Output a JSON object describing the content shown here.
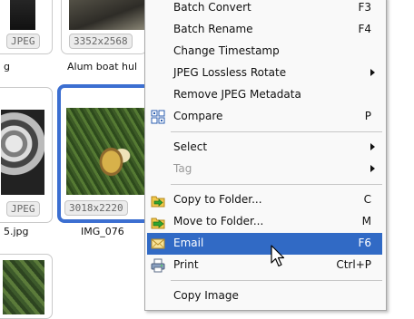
{
  "thumbnails": [
    {
      "badge": "JPEG",
      "name": ""
    },
    {
      "badge": "3352x2568",
      "name": "Alum boat hul"
    },
    {
      "badge": "JPEG",
      "name": "g"
    },
    {
      "badge": "JPEG",
      "name": "5.jpg"
    },
    {
      "badge": "3018x2220",
      "name": "IMG_076"
    }
  ],
  "menu": {
    "items": {
      "batch_convert": {
        "label": "Batch Convert",
        "shortcut": "F3"
      },
      "batch_rename": {
        "label": "Batch Rename",
        "shortcut": "F4"
      },
      "change_timestamp": {
        "label": "Change Timestamp"
      },
      "lossless_rotate": {
        "label": "JPEG Lossless Rotate"
      },
      "remove_metadata": {
        "label": "Remove JPEG Metadata"
      },
      "compare": {
        "label": "Compare",
        "shortcut": "P",
        "icon": "compare-icon"
      },
      "select": {
        "label": "Select"
      },
      "tag": {
        "label": "Tag"
      },
      "copy_to_folder": {
        "label": "Copy to Folder...",
        "shortcut": "C",
        "icon": "copy-folder-icon"
      },
      "move_to_folder": {
        "label": "Move to Folder...",
        "shortcut": "M",
        "icon": "move-folder-icon"
      },
      "email": {
        "label": "Email",
        "shortcut": "F6",
        "icon": "envelope-icon"
      },
      "print": {
        "label": "Print",
        "shortcut": "Ctrl+P",
        "icon": "printer-icon"
      },
      "copy_image": {
        "label": "Copy Image"
      }
    },
    "highlight_color": "#316ac5"
  }
}
